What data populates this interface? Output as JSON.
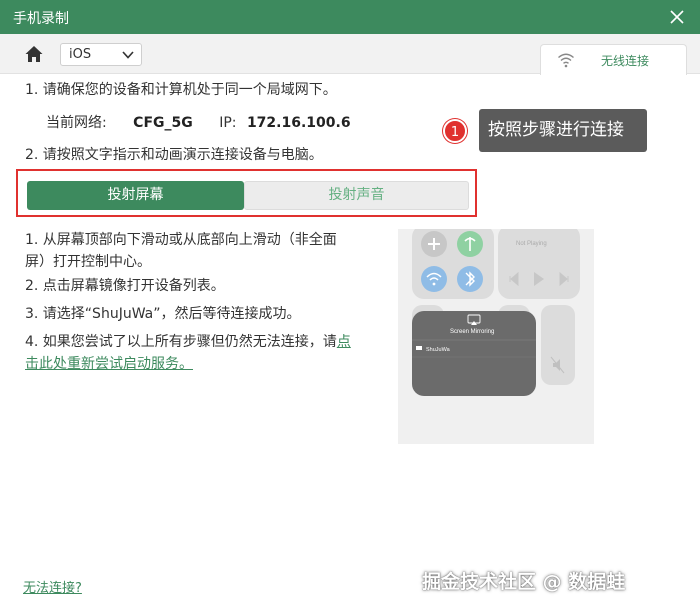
{
  "window": {
    "title": "手机录制"
  },
  "toolbar": {
    "os_value": "iOS",
    "wireless_tab": "无线连接"
  },
  "steps": {
    "s1": "1. 请确保您的设备和计算机处于同一个局域网下。",
    "net_label": "当前网络:",
    "net_name": "CFG_5G",
    "ip_label": "IP:",
    "ip_value": "172.16.100.6",
    "s2": "2. 请按照文字指示和动画演示连接设备与电脑。"
  },
  "callout": {
    "number": "1",
    "text": "按照步骤进行连接"
  },
  "segments": {
    "left": "投射屏幕",
    "right": "投射声音"
  },
  "instructions": {
    "i1a": "1. 从屏幕顶部向下滑动或从底部向上滑动（非全面",
    "i1b": "屏）打开控制中心。",
    "i2": "2. 点击屏幕镜像打开设备列表。",
    "i3": "3. 请选择“ShuJuWa”，然后等待连接成功。",
    "i4a": "4. 如果您尝试了以上所有步骤但仍然无法连接，请",
    "i4link1": "点",
    "i4link2": "击此处重新尝试启动服务。"
  },
  "phone": {
    "now_playing": "Not Playing",
    "mirroring_title": "Screen Mirroring",
    "device_name": "ShuJuWa"
  },
  "footer": {
    "cannot_connect": "无法连接?"
  },
  "watermark": "掘金技术社区 @ 数据蛙",
  "colors": {
    "brand": "#3d8a5e",
    "highlight": "#e0312f"
  }
}
